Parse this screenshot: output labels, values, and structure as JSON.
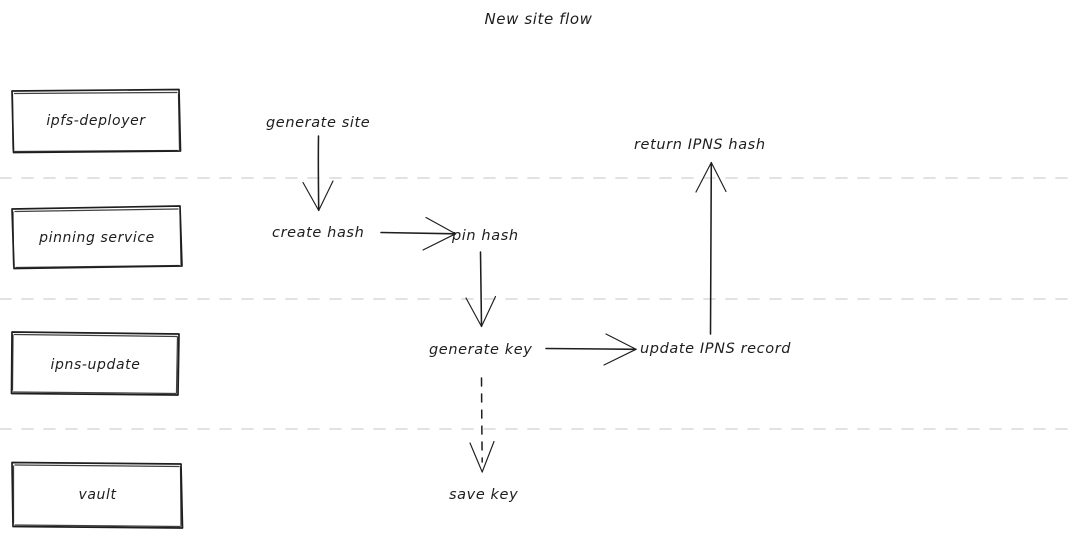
{
  "title": "New site flow",
  "lanes": [
    {
      "label": "ipfs-deployer"
    },
    {
      "label": "pinning service"
    },
    {
      "label": "ipns-update"
    },
    {
      "label": "vault"
    }
  ],
  "steps": [
    {
      "label": "generate site"
    },
    {
      "label": "create hash"
    },
    {
      "label": "pin hash"
    },
    {
      "label": "generate key"
    },
    {
      "label": "update IPNS record"
    },
    {
      "label": "return IPNS hash"
    },
    {
      "label": "save key"
    }
  ],
  "colors": {
    "background": "#ffffff",
    "stroke": "#1e1e1e",
    "divider": "#d8d8d8"
  }
}
